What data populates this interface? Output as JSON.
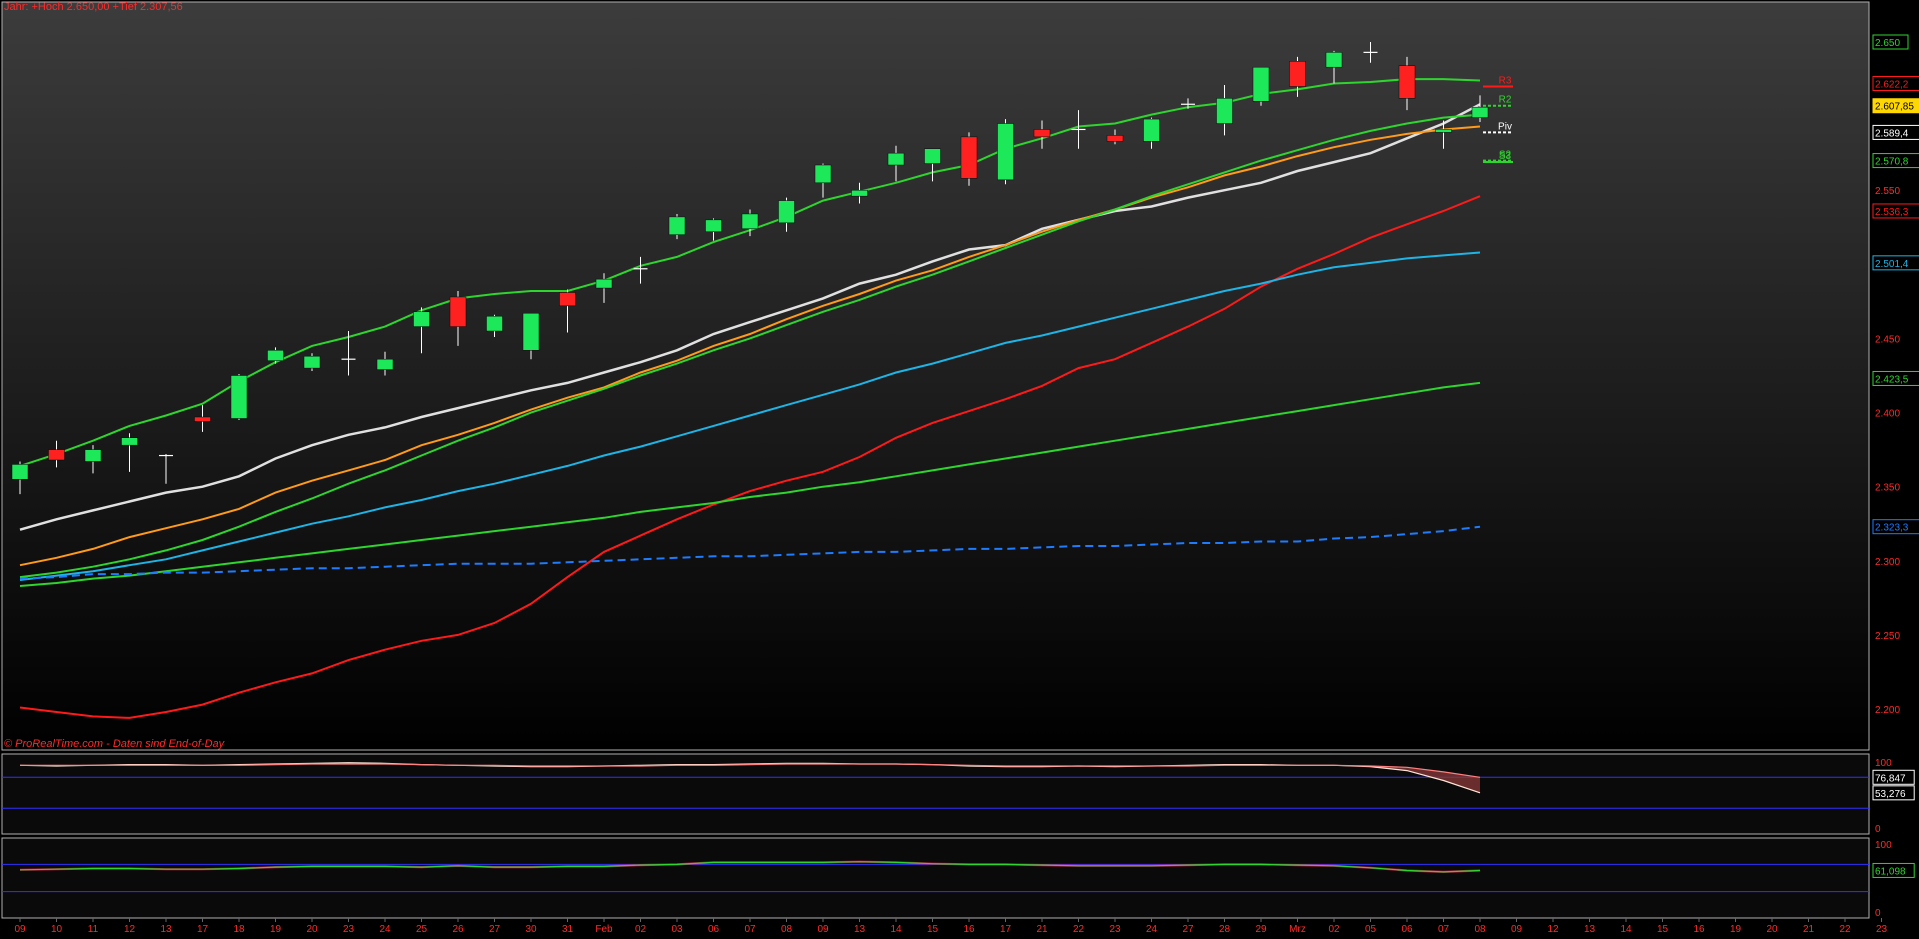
{
  "header": {
    "title": "Jahr: +Hoch 2.650,00 +Tief 2.307,56",
    "source": "© ProRealTime.com - Daten sind End-of-Day"
  },
  "colors": {
    "background_top": "#3c3c3c",
    "background_bottom": "#000000",
    "up_candle": "#1de85a",
    "down_candle": "#ff2020",
    "wick": "#ffffff",
    "axis_text": "#ff2a2a",
    "panel_border": "#b0b0b0"
  },
  "chart_data": [
    {
      "type": "candlestick",
      "panel": "price",
      "ylim": [
        2175,
        2675
      ],
      "y_ticks": [
        "2.650",
        "2.550",
        "2.450",
        "2.400",
        "2.350",
        "2.300",
        "2.250",
        "2.200"
      ],
      "x_tick_labels": [
        "09",
        "10",
        "11",
        "12",
        "13",
        "17",
        "18",
        "19",
        "20",
        "23",
        "24",
        "25",
        "26",
        "27",
        "30",
        "31",
        "Feb",
        "02",
        "03",
        "06",
        "07",
        "08",
        "09",
        "13",
        "14",
        "15",
        "16",
        "17",
        "21",
        "22",
        "23",
        "24",
        "27",
        "28",
        "29",
        "Mrz",
        "02",
        "05",
        "06",
        "07",
        "08",
        "09",
        "12",
        "13",
        "14",
        "15",
        "16",
        "19",
        "20",
        "21",
        "22",
        "23"
      ],
      "candles": [
        {
          "d": "09",
          "o": 2355,
          "h": 2367,
          "l": 2345,
          "c": 2365
        },
        {
          "d": "10",
          "o": 2375,
          "h": 2381,
          "l": 2363,
          "c": 2368
        },
        {
          "d": "11",
          "o": 2367,
          "h": 2378,
          "l": 2359,
          "c": 2375
        },
        {
          "d": "12",
          "o": 2378,
          "h": 2386,
          "l": 2360,
          "c": 2383
        },
        {
          "d": "13",
          "o": 2371,
          "h": 2372,
          "l": 2352,
          "c": 2371
        },
        {
          "d": "17",
          "o": 2397,
          "h": 2405,
          "l": 2387,
          "c": 2394
        },
        {
          "d": "18",
          "o": 2396,
          "h": 2426,
          "l": 2395,
          "c": 2425
        },
        {
          "d": "19",
          "o": 2435,
          "h": 2444,
          "l": 2433,
          "c": 2442
        },
        {
          "d": "20",
          "o": 2430,
          "h": 2440,
          "l": 2428,
          "c": 2438
        },
        {
          "d": "23",
          "o": 2436,
          "h": 2455,
          "l": 2425,
          "c": 2436
        },
        {
          "d": "24",
          "o": 2429,
          "h": 2441,
          "l": 2425,
          "c": 2436
        },
        {
          "d": "25",
          "o": 2458,
          "h": 2471,
          "l": 2440,
          "c": 2468
        },
        {
          "d": "26",
          "o": 2478,
          "h": 2482,
          "l": 2445,
          "c": 2458
        },
        {
          "d": "27",
          "o": 2455,
          "h": 2466,
          "l": 2451,
          "c": 2465
        },
        {
          "d": "30",
          "o": 2442,
          "h": 2466,
          "l": 2436,
          "c": 2467
        },
        {
          "d": "31",
          "o": 2481,
          "h": 2483,
          "l": 2454,
          "c": 2472
        },
        {
          "d": "Feb",
          "o": 2484,
          "h": 2494,
          "l": 2474,
          "c": 2490
        },
        {
          "d": "02",
          "o": 2497,
          "h": 2505,
          "l": 2487,
          "c": 2497
        },
        {
          "d": "03",
          "o": 2520,
          "h": 2534,
          "l": 2517,
          "c": 2532
        },
        {
          "d": "06",
          "o": 2522,
          "h": 2531,
          "l": 2516,
          "c": 2530
        },
        {
          "d": "07",
          "o": 2524,
          "h": 2537,
          "l": 2519,
          "c": 2534
        },
        {
          "d": "08",
          "o": 2528,
          "h": 2545,
          "l": 2522,
          "c": 2543
        },
        {
          "d": "09",
          "o": 2555,
          "h": 2568,
          "l": 2545,
          "c": 2567
        },
        {
          "d": "13",
          "o": 2546,
          "h": 2555,
          "l": 2541,
          "c": 2550
        },
        {
          "d": "14",
          "o": 2567,
          "h": 2580,
          "l": 2556,
          "c": 2575
        },
        {
          "d": "15",
          "o": 2568,
          "h": 2577,
          "l": 2556,
          "c": 2578
        },
        {
          "d": "16",
          "o": 2586,
          "h": 2589,
          "l": 2553,
          "c": 2558
        },
        {
          "d": "17",
          "o": 2557,
          "h": 2598,
          "l": 2554,
          "c": 2595
        },
        {
          "d": "21",
          "o": 2591,
          "h": 2597,
          "l": 2578,
          "c": 2586
        },
        {
          "d": "22",
          "o": 2591,
          "h": 2604,
          "l": 2578,
          "c": 2591
        },
        {
          "d": "23",
          "o": 2587,
          "h": 2591,
          "l": 2581,
          "c": 2583
        },
        {
          "d": "24",
          "o": 2583,
          "h": 2599,
          "l": 2578,
          "c": 2598
        },
        {
          "d": "27",
          "o": 2608,
          "h": 2612,
          "l": 2605,
          "c": 2608
        },
        {
          "d": "28",
          "o": 2595,
          "h": 2621,
          "l": 2587,
          "c": 2612
        },
        {
          "d": "29",
          "o": 2610,
          "h": 2632,
          "l": 2607,
          "c": 2633
        },
        {
          "d": "Mrz",
          "o": 2637,
          "h": 2640,
          "l": 2613,
          "c": 2620
        },
        {
          "d": "02",
          "o": 2633,
          "h": 2644,
          "l": 2622,
          "c": 2643
        },
        {
          "d": "05",
          "o": 2643,
          "h": 2650,
          "l": 2636,
          "c": 2643
        },
        {
          "d": "06",
          "o": 2634,
          "h": 2640,
          "l": 2604,
          "c": 2612
        },
        {
          "d": "07",
          "o": 2589,
          "h": 2597,
          "l": 2578,
          "c": 2591
        },
        {
          "d": "08",
          "o": 2599,
          "h": 2614,
          "l": 2596,
          "c": 2606
        }
      ],
      "series": [
        {
          "color": "#2fd52f",
          "dash": false,
          "values": [
            2364,
            2372,
            2381,
            2391,
            2398,
            2406,
            2421,
            2434,
            2445,
            2451,
            2458,
            2469,
            2477,
            2480,
            2482,
            2482,
            2489,
            2499,
            2505,
            2515,
            2523,
            2532,
            2543,
            2549,
            2555,
            2562,
            2567,
            2578,
            2585,
            2593,
            2595,
            2601,
            2606,
            2609,
            2615,
            2618,
            2622,
            2623,
            2625,
            2625,
            2624
          ]
        },
        {
          "color": "#e0e0e0",
          "dash": false,
          "values": [
            2321,
            2328,
            2334,
            2340,
            2346,
            2350,
            2357,
            2369,
            2378,
            2385,
            2390,
            2397,
            2403,
            2409,
            2415,
            2420,
            2427,
            2434,
            2442,
            2453,
            2461,
            2469,
            2477,
            2487,
            2493,
            2502,
            2510,
            2513,
            2524,
            2530,
            2536,
            2539,
            2545,
            2550,
            2555,
            2563,
            2569,
            2575,
            2585,
            2595,
            2608
          ]
        },
        {
          "color": "#ff9a1a",
          "dash": false,
          "values": [
            2297,
            2302,
            2308,
            2316,
            2322,
            2328,
            2335,
            2346,
            2354,
            2361,
            2368,
            2378,
            2385,
            2393,
            2402,
            2410,
            2417,
            2427,
            2435,
            2445,
            2453,
            2463,
            2472,
            2480,
            2489,
            2496,
            2505,
            2513,
            2522,
            2530,
            2537,
            2545,
            2552,
            2560,
            2566,
            2573,
            2579,
            2584,
            2588,
            2591,
            2593
          ]
        },
        {
          "color": "#2fd52f",
          "dash": false,
          "values": [
            2289,
            2292,
            2296,
            2301,
            2307,
            2314,
            2323,
            2333,
            2342,
            2352,
            2361,
            2371,
            2381,
            2390,
            2400,
            2408,
            2416,
            2425,
            2433,
            2442,
            2450,
            2459,
            2468,
            2476,
            2485,
            2493,
            2502,
            2511,
            2520,
            2529,
            2537,
            2546,
            2554,
            2562,
            2570,
            2577,
            2584,
            2590,
            2595,
            2599,
            2601
          ]
        },
        {
          "color": "#ff1a1a",
          "dash": false,
          "values": [
            2201,
            2198,
            2195,
            2194,
            2198,
            2203,
            2211,
            2218,
            2224,
            2233,
            2240,
            2246,
            2250,
            2258,
            2271,
            2289,
            2306,
            2317,
            2328,
            2338,
            2347,
            2354,
            2360,
            2370,
            2383,
            2393,
            2401,
            2409,
            2418,
            2430,
            2436,
            2447,
            2458,
            2470,
            2485,
            2497,
            2507,
            2518,
            2527,
            2536,
            2546
          ]
        },
        {
          "color": "#1eb4e6",
          "dash": false,
          "values": [
            2287,
            2290,
            2293,
            2297,
            2301,
            2307,
            2313,
            2319,
            2325,
            2330,
            2336,
            2341,
            2347,
            2352,
            2358,
            2364,
            2371,
            2377,
            2384,
            2391,
            2398,
            2405,
            2412,
            2419,
            2427,
            2433,
            2440,
            2447,
            2452,
            2458,
            2464,
            2470,
            2476,
            2482,
            2487,
            2493,
            2498,
            2501,
            2504,
            2506,
            2508
          ]
        },
        {
          "color": "#2fd52f",
          "dash": false,
          "values": [
            2283,
            2285,
            2288,
            2290,
            2293,
            2296,
            2299,
            2302,
            2305,
            2308,
            2311,
            2314,
            2317,
            2320,
            2323,
            2326,
            2329,
            2333,
            2336,
            2339,
            2343,
            2346,
            2350,
            2353,
            2357,
            2361,
            2365,
            2369,
            2373,
            2377,
            2381,
            2385,
            2389,
            2393,
            2397,
            2401,
            2405,
            2409,
            2413,
            2417,
            2420
          ]
        },
        {
          "color": "#1e7cff",
          "dash": true,
          "values": [
            2288,
            2289,
            2291,
            2291,
            2292,
            2292,
            2293,
            2294,
            2295,
            2295,
            2296,
            2297,
            2298,
            2298,
            2298,
            2299,
            2300,
            2301,
            2302,
            2303,
            2303,
            2304,
            2305,
            2306,
            2306,
            2307,
            2308,
            2308,
            2309,
            2310,
            2310,
            2311,
            2312,
            2312,
            2313,
            2313,
            2315,
            2316,
            2318,
            2320,
            2323
          ]
        }
      ],
      "pivots": [
        {
          "label": "R3",
          "value": 2620,
          "color": "#ff1a1a",
          "dash": false
        },
        {
          "label": "R2",
          "value": 2607,
          "color": "#2fd52f",
          "dash": true
        },
        {
          "label": "Piv",
          "value": 2589,
          "color": "#ffffff",
          "dash": true
        },
        {
          "label": "S2",
          "value": 2570,
          "color": "#2fd52f",
          "dash": true
        },
        {
          "label": "S3",
          "value": 2569,
          "color": "#2fd52f",
          "dash": false
        }
      ],
      "value_badges": [
        {
          "text": "2.650",
          "value": 2650,
          "color": "#2fd52f",
          "fill": false
        },
        {
          "text": "2.622,2",
          "value": 2622,
          "color": "#ff1a1a",
          "fill": false
        },
        {
          "text": "2.607,85",
          "value": 2607,
          "color": "#ffd700",
          "fill": true
        },
        {
          "text": "2.589,4",
          "value": 2589,
          "color": "#ffffff",
          "fill": false
        },
        {
          "text": "2.570,8",
          "value": 2570,
          "color": "#2fd52f",
          "fill": false
        },
        {
          "text": "2.536,3",
          "value": 2536,
          "color": "#ff1a1a",
          "fill": false
        },
        {
          "text": "2.501,4",
          "value": 2501,
          "color": "#1eb4e6",
          "fill": false
        },
        {
          "text": "2.423,5",
          "value": 2423,
          "color": "#2fd52f",
          "fill": false
        },
        {
          "text": "2.323,3",
          "value": 2323,
          "color": "#1e7cff",
          "fill": false
        }
      ]
    },
    {
      "type": "line",
      "panel": "oscillator_1",
      "ylim": [
        0,
        100
      ],
      "y_ticks": [
        "100",
        "0"
      ],
      "reference_lines": [
        76.847,
        30
      ],
      "series": [
        {
          "name": "",
          "color": "#ffe4d6",
          "values": [
            95,
            94,
            95,
            96,
            96,
            95,
            96,
            97,
            98,
            99,
            98,
            96,
            95,
            94,
            93,
            93,
            94,
            95,
            96,
            96,
            97,
            98,
            98,
            97,
            97,
            96,
            94,
            93,
            93,
            94,
            93,
            94,
            95,
            96,
            96,
            95,
            95,
            93,
            87,
            72,
            53.276
          ]
        },
        {
          "name": "",
          "color": "#ff8080",
          "values": [
            95,
            95,
            95,
            95,
            95,
            95,
            95,
            96,
            97,
            97,
            97,
            96,
            95,
            95,
            94,
            94,
            94,
            94,
            95,
            95,
            96,
            97,
            97,
            97,
            97,
            96,
            95,
            94,
            94,
            94,
            94,
            94,
            94,
            95,
            95,
            95,
            95,
            94,
            92,
            85,
            76.847
          ]
        }
      ],
      "value_badges": [
        {
          "text": "76,847",
          "value": 76.847,
          "color": "#ffffff"
        },
        {
          "text": "53,276",
          "value": 53.276,
          "color": "#ffffff"
        }
      ]
    },
    {
      "type": "line",
      "panel": "oscillator_2",
      "ylim": [
        0,
        100
      ],
      "y_ticks": [
        "100",
        "0"
      ],
      "reference_lines": [
        70,
        30
      ],
      "series": [
        {
          "name": "",
          "color": "#2fd52f",
          "values": [
            62,
            63,
            64,
            64,
            63,
            63,
            64,
            66,
            67,
            67,
            67,
            66,
            68,
            66,
            66,
            67,
            67,
            69,
            70,
            73,
            73,
            73,
            73,
            74,
            73,
            71,
            70,
            70,
            69,
            68,
            68,
            68,
            69,
            70,
            70,
            69,
            68,
            65,
            61,
            59,
            61.098
          ]
        }
      ],
      "value_badges": [
        {
          "text": "61,098",
          "value": 61.098,
          "color": "#2fd52f"
        }
      ]
    }
  ]
}
